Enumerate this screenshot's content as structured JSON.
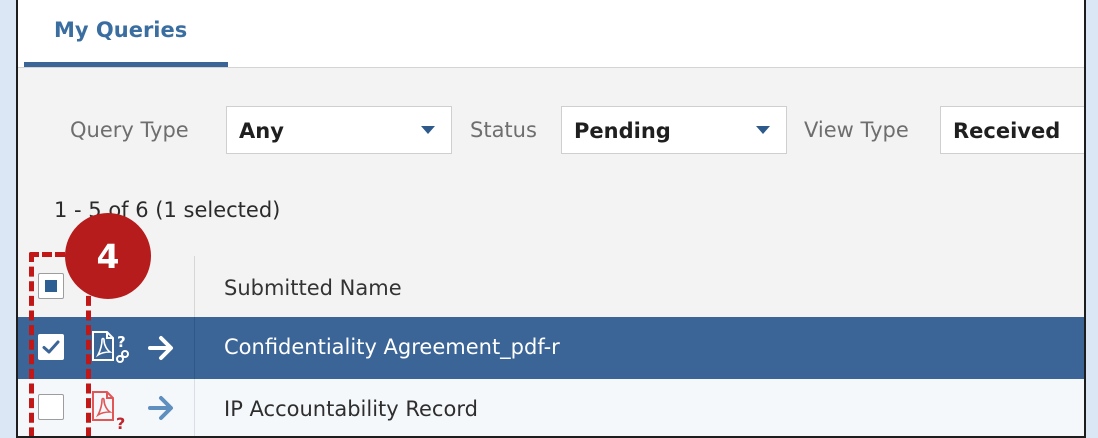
{
  "tabs": [
    {
      "label": "My Queries",
      "active": true
    }
  ],
  "filters": {
    "query_type": {
      "label": "Query Type",
      "value": "Any"
    },
    "status": {
      "label": "Status",
      "value": "Pending"
    },
    "view_type": {
      "label": "View Type",
      "value": "Received"
    }
  },
  "grid": {
    "count_text": "1 - 5 of 6 (1 selected)",
    "header": {
      "submitted_name": "Submitted Name"
    },
    "rows": [
      {
        "name": "Confidentiality Agreement_pdf-r",
        "selected": true,
        "file_icon": "pdf-linked-query-icon",
        "action_icon": "arrow-right-icon"
      },
      {
        "name": "IP Accountability Record",
        "selected": false,
        "file_icon": "pdf-query-icon",
        "action_icon": "arrow-right-icon"
      }
    ]
  },
  "callout": {
    "number": "4"
  },
  "colors": {
    "accent": "#3b6597",
    "tab_text": "#3b6ea0",
    "callout_red": "#b71c1c",
    "pdf_red": "#e15656",
    "question_red": "#c0262d"
  }
}
